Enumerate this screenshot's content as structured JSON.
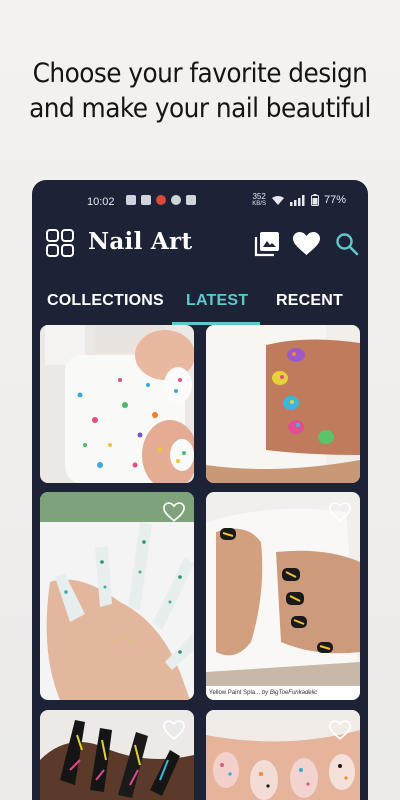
{
  "promo": {
    "line1": "Choose your favorite design",
    "line2": "and make your nail beautiful"
  },
  "statusbar": {
    "time": "10:02",
    "netspeed_value": "352",
    "netspeed_unit": "KB/S",
    "battery": "77%"
  },
  "appbar": {
    "title": "Nail Art",
    "icons": [
      "grid-icon",
      "gallery-icon",
      "heart-icon",
      "search-icon"
    ]
  },
  "tabs": [
    {
      "label": "COLLECTIONS",
      "active": false
    },
    {
      "label": "LATEST",
      "active": true
    },
    {
      "label": "RECENT",
      "active": false
    }
  ],
  "gallery": {
    "items": [
      {
        "id": "polish-bottle-speckled",
        "favorite_icon": false
      },
      {
        "id": "rainbow-speckle-mug",
        "favorite_icon": false
      },
      {
        "id": "mint-speckle-coffin",
        "favorite_icon": true
      },
      {
        "id": "yellow-paint-splatter",
        "favorite_icon": true,
        "caption_title": "Yellow Paint Spla...",
        "caption_by": "by BigToeFunkadelic"
      },
      {
        "id": "black-neon-stiletto",
        "favorite_icon": true
      },
      {
        "id": "pastel-splatter",
        "favorite_icon": true
      }
    ]
  },
  "colors": {
    "background": "#eceae8",
    "panel": "#1d2337",
    "accent": "#5ec9cc",
    "text_light": "#ffffff"
  }
}
